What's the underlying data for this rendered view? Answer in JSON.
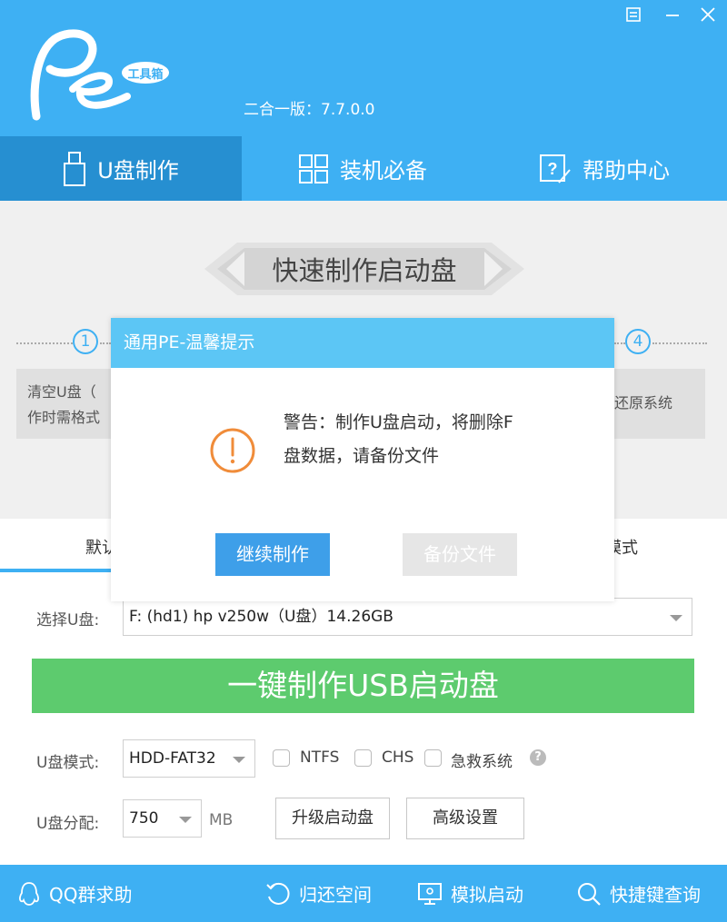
{
  "header": {
    "logo_text": "工具箱",
    "version": "二合一版：7.7.0.0",
    "controls": [
      "menu-icon",
      "minimize-icon",
      "close-icon"
    ]
  },
  "nav": {
    "tabs": [
      {
        "label": "U盘制作",
        "icon": "usb-icon",
        "active": true
      },
      {
        "label": "装机必备",
        "icon": "grid-icon",
        "active": false
      },
      {
        "label": "帮助中心",
        "icon": "help-icon",
        "active": false
      }
    ]
  },
  "main": {
    "banner": "快速制作启动盘",
    "step1_num": "1",
    "step4_num": "4",
    "step1_text_line1": "清空U盘（",
    "step1_text_line2": "作时需格式",
    "step4_text": "还原系统"
  },
  "modes": {
    "tab_left": "默认",
    "tab_right": "模式"
  },
  "form": {
    "usb_label": "选择U盘:",
    "usb_value": "F: (hd1) hp v250w（U盘）14.26GB",
    "make_button": "一键制作USB启动盘",
    "mode_label": "U盘模式:",
    "mode_value": "HDD-FAT32",
    "ntfs": "NTFS",
    "chs": "CHS",
    "rescue": "急救系统",
    "help_icon": "?",
    "partition_label": "U盘分配:",
    "partition_value": "750",
    "partition_unit": "MB",
    "upgrade_button": "升级启动盘",
    "advanced_button": "高级设置"
  },
  "footer": {
    "qq": "QQ群求助",
    "restore": "归还空间",
    "simulate": "模拟启动",
    "shortcut": "快捷键查询"
  },
  "dialog": {
    "title": "通用PE-温馨提示",
    "message_line1": "警告：制作U盘启动，将删除F",
    "message_line2": "盘数据，请备份文件",
    "continue_button": "继续制作",
    "backup_button": "备份文件"
  },
  "colors": {
    "primary": "#3eb0f3",
    "active_tab": "#268fd1",
    "make_button": "#5dcb6e",
    "dialog_title": "#5cc6f5",
    "warning": "#f08c3a"
  }
}
